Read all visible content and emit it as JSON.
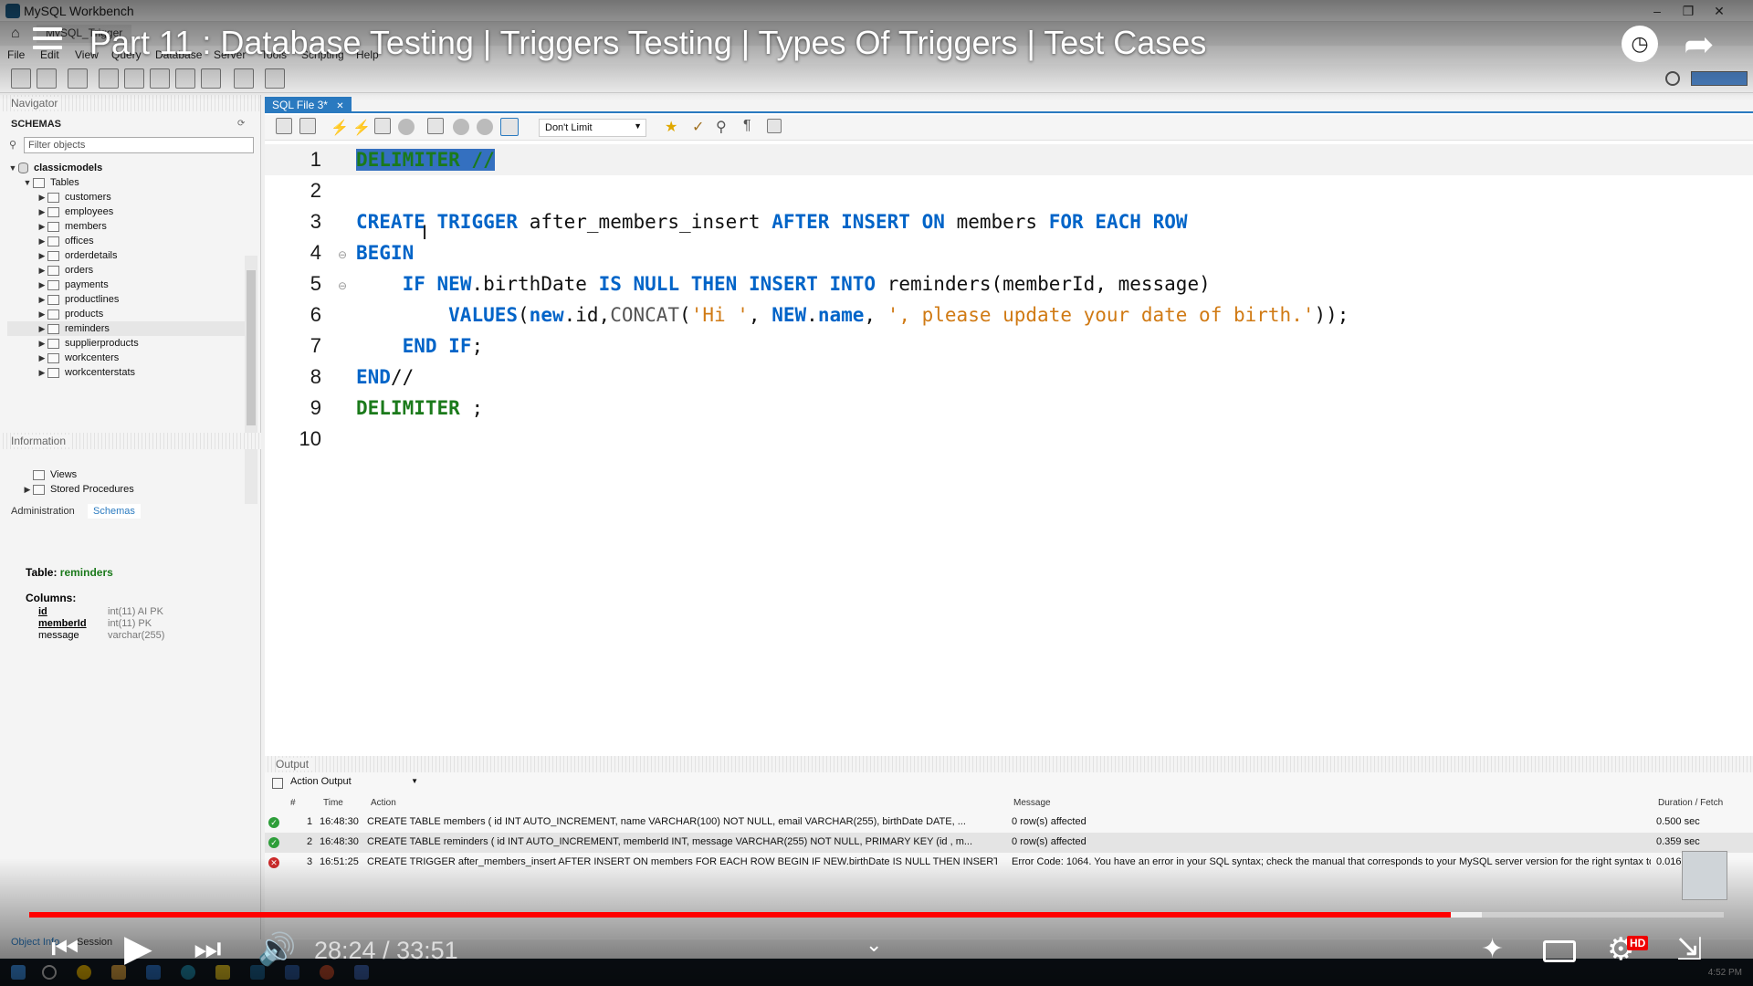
{
  "window": {
    "app_title": "MySQL Workbench",
    "connection_tab": "MySQL_Trigger"
  },
  "menu": [
    "File",
    "Edit",
    "View",
    "Query",
    "Database",
    "Server",
    "Tools",
    "Scripting",
    "Help"
  ],
  "navigator": {
    "header": "Navigator",
    "schemas_title": "SCHEMAS",
    "filter_placeholder": "Filter objects",
    "schema_name": "classicmodels",
    "tables_label": "Tables",
    "tables": [
      "customers",
      "employees",
      "members",
      "offices",
      "orderdetails",
      "orders",
      "payments",
      "productlines",
      "products",
      "reminders",
      "supplierproducts",
      "workcenters",
      "workcenterstats"
    ],
    "selected_table": "reminders",
    "views_label": "Views",
    "procedures_label": "Stored Procedures",
    "tabs": [
      "Administration",
      "Schemas"
    ],
    "active_tab": "Schemas"
  },
  "information": {
    "header": "Information",
    "table_label": "Table:",
    "table_name": "reminders",
    "columns_label": "Columns:",
    "columns": [
      {
        "name": "id",
        "type": "int(11) AI PK"
      },
      {
        "name": "memberId",
        "type": "int(11) PK"
      },
      {
        "name": "message",
        "type": "varchar(255)"
      }
    ]
  },
  "editor": {
    "tab_label": "SQL File 3*",
    "limit_value": "Don't Limit",
    "line_numbers": [
      "1",
      "2",
      "3",
      "4",
      "5",
      "6",
      "7",
      "8",
      "9",
      "10"
    ]
  },
  "output": {
    "header": "Output",
    "selector": "Action Output",
    "columns": [
      "#",
      "Time",
      "Action",
      "Message",
      "Duration / Fetch"
    ],
    "rows": [
      {
        "num": "1",
        "time": "16:48:30",
        "action": "CREATE TABLE members (     id INT AUTO_INCREMENT,     name VARCHAR(100) NOT NULL,     email VARCHAR(255),     birthDate DATE,     ...",
        "message": "0 row(s) affected",
        "duration": "0.500 sec",
        "status": "ok"
      },
      {
        "num": "2",
        "time": "16:48:30",
        "action": "CREATE TABLE reminders (     id INT AUTO_INCREMENT,     memberId INT,     message VARCHAR(255) NOT NULL,     PRIMARY KEY (id , m...",
        "message": "0 row(s) affected",
        "duration": "0.359 sec",
        "status": "ok"
      },
      {
        "num": "3",
        "time": "16:51:25",
        "action": "CREATE TRIGGER after_members_insert AFTER INSERT ON members FOR EACH ROW BEGIN     IF NEW.birthDate IS NULL THEN INSERT ...",
        "message": "Error Code: 1064. You have an error in your SQL syntax; check the manual that corresponds to your MySQL server version for the right syntax to u...",
        "duration": "0.016 sec",
        "status": "error"
      }
    ]
  },
  "bottom_tabs": [
    "Object Info",
    "Session"
  ],
  "taskbar": {
    "clock": "4:52 PM"
  },
  "video": {
    "title": "Part 11 : Database Testing | Triggers Testing | Types Of Triggers | Test Cases",
    "time": "28:24 / 33:51",
    "current_time": "28:24",
    "duration": "33:51",
    "progress_fraction": 0.839,
    "hd_badge": "HD"
  },
  "colors": {
    "keyword": "#0064c8",
    "delimiter_keyword": "#1b7a1b",
    "string": "#d07a14",
    "tab_accent": "#2a7ac0",
    "progress": "#ff0000"
  }
}
